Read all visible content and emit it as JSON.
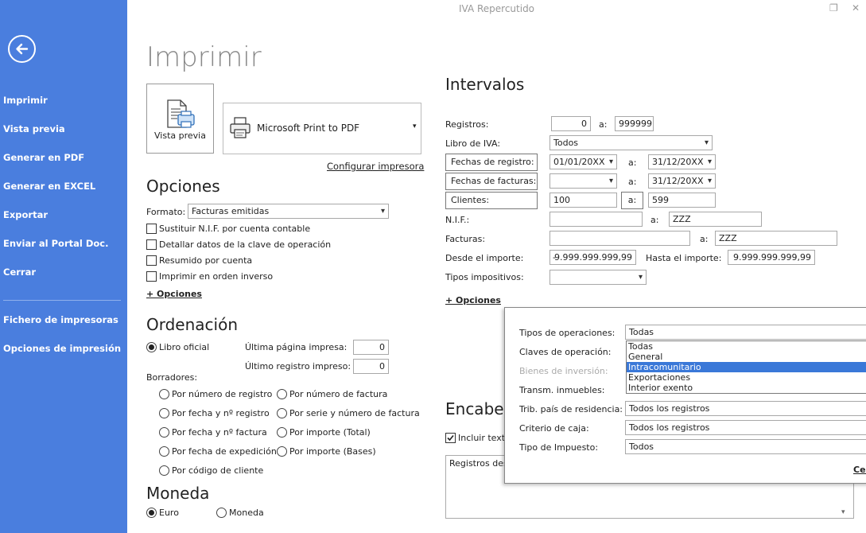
{
  "window": {
    "title": "IVA Repercutido"
  },
  "sidebar": {
    "items": [
      "Imprimir",
      "Vista previa",
      "Generar en PDF",
      "Generar en EXCEL",
      "Exportar",
      "Enviar al Portal Doc.",
      "Cerrar"
    ],
    "items2": [
      "Fichero de impresoras",
      "Opciones de impresión"
    ]
  },
  "page": {
    "title": "Imprimir"
  },
  "print": {
    "preview_label": "Vista previa",
    "printer": "Microsoft Print to PDF",
    "configure": "Configurar impresora"
  },
  "options": {
    "title": "Opciones",
    "format_label": "Formato:",
    "format_value": "Facturas emitidas",
    "checks": [
      "Sustituir N.I.F. por cuenta contable",
      "Detallar datos de la clave de operación",
      "Resumido por cuenta",
      "Imprimir en orden inverso"
    ],
    "more": "+ Opciones"
  },
  "order": {
    "title": "Ordenación",
    "libro": "Libro oficial",
    "last_page_label": "Última página impresa:",
    "last_page": "0",
    "last_reg_label": "Último registro impreso:",
    "last_reg": "0",
    "drafts_label": "Borradores:",
    "left": [
      "Por número de registro",
      "Por fecha y nº registro",
      "Por fecha y nº factura",
      "Por fecha de expedición",
      "Por código de cliente"
    ],
    "right": [
      "Por número de factura",
      "Por serie y número de factura",
      "Por importe (Total)",
      "Por importe (Bases)"
    ]
  },
  "currency": {
    "title": "Moneda",
    "euro": "Euro",
    "moneda": "Moneda"
  },
  "intervals": {
    "title": "Intervalos",
    "a": "a:",
    "registros_label": "Registros:",
    "reg_from": "0",
    "reg_to": "999999",
    "libro_label": "Libro de IVA:",
    "libro_value": "Todos",
    "fechas_reg_btn": "Fechas de registro:",
    "fr_from": "01/01/20XX",
    "fr_to": "31/12/20XX",
    "fechas_fac_btn": "Fechas de facturas:",
    "ff_from": "",
    "ff_to": "31/12/20XX",
    "clientes_btn": "Clientes:",
    "cli_from": "100",
    "cli_to": "599",
    "nif_label": "N.I.F.:",
    "nif_from": "",
    "nif_to": "ZZZ",
    "fact_label": "Facturas:",
    "fact_from": "",
    "fact_to": "ZZZ",
    "imp_from_label": "Desde el importe:",
    "imp_from_sign": "-",
    "imp_from": "9.999.999.999,99",
    "imp_to_label": "Hasta el importe:",
    "imp_to": "9.999.999.999,99",
    "tipos_label": "Tipos impositivos:",
    "tipos_value": "",
    "more": "+ Opciones"
  },
  "header": {
    "title": "Encabez",
    "include": "Incluir texto",
    "text": "Registros des"
  },
  "popup": {
    "tipos_op_label": "Tipos de operaciones:",
    "tipos_op_value": "Todas",
    "claves_label": "Claves de operación:",
    "bienes_label": "Bienes de inversión:",
    "transm_label": "Transm. inmuebles:",
    "trib_label": "Trib. país de residencia:",
    "trib_value": "Todos los registros",
    "criterio_label": "Criterio de caja:",
    "criterio_value": "Todos los registros",
    "tipo_imp_label": "Tipo de Impuesto:",
    "tipo_imp_value": "Todos",
    "list": [
      "Todas",
      "General",
      "Intracomunitario",
      "Exportaciones",
      "Interior exento"
    ],
    "selected_index": 2,
    "cancel": "Cer"
  },
  "colors": {
    "sidebar": "#4a7ede",
    "selection": "#3a78d8"
  }
}
